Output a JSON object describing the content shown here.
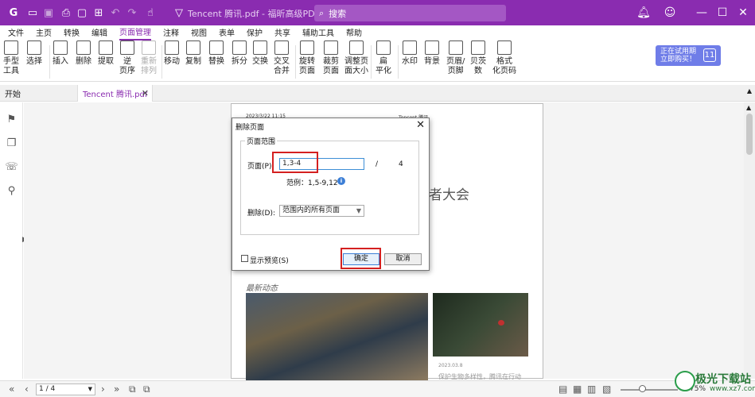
{
  "app": {
    "title": "Tencent 腾讯.pdf - 福昕高级PDF编辑器",
    "search_placeholder": "搜索",
    "accent": "#8a2cb0"
  },
  "menu": {
    "items": [
      "文件",
      "主页",
      "转换",
      "编辑",
      "页面管理",
      "注释",
      "视图",
      "表单",
      "保护",
      "共享",
      "辅助工具",
      "帮助"
    ],
    "active": "页面管理"
  },
  "ribbon": {
    "buttons": [
      {
        "label": "手型\n工具",
        "icon": "hand-icon"
      },
      {
        "label": "选择",
        "icon": "select-cursor-icon"
      },
      {
        "label": "插入",
        "icon": "insert-page-icon"
      },
      {
        "label": "删除",
        "icon": "delete-page-icon"
      },
      {
        "label": "提取",
        "icon": "extract-page-icon"
      },
      {
        "label": "逆\n页序",
        "icon": "reverse-order-icon"
      },
      {
        "label": "重新\n排列",
        "icon": "rearrange-icon"
      },
      {
        "label": "移动",
        "icon": "move-page-icon"
      },
      {
        "label": "复制",
        "icon": "copy-page-icon"
      },
      {
        "label": "替换",
        "icon": "replace-page-icon"
      },
      {
        "label": "拆分",
        "icon": "split-icon"
      },
      {
        "label": "交换",
        "icon": "swap-icon"
      },
      {
        "label": "交叉\n合并",
        "icon": "cross-merge-icon"
      },
      {
        "label": "旋转\n页面",
        "icon": "rotate-page-icon"
      },
      {
        "label": "裁剪\n页面",
        "icon": "crop-page-icon"
      },
      {
        "label": "调整页\n面大小",
        "icon": "resize-page-icon"
      },
      {
        "label": "扁\n平化",
        "icon": "flatten-icon"
      },
      {
        "label": "水印",
        "icon": "watermark-icon"
      },
      {
        "label": "背景",
        "icon": "background-icon"
      },
      {
        "label": "页眉/\n页脚",
        "icon": "header-footer-icon"
      },
      {
        "label": "贝茨\n数",
        "icon": "bates-number-icon"
      },
      {
        "label": "格式\n化页码",
        "icon": "format-page-number-icon"
      }
    ],
    "promo_line1": "正在试用期",
    "promo_line2": "立即购买！",
    "promo_badge": "11"
  },
  "tabs": [
    {
      "label": "开始"
    },
    {
      "label": "Tencent 腾讯.pdf"
    }
  ],
  "document": {
    "header_left": "2023/3/22 11:15",
    "header_right": "Tencent 腾讯",
    "title_fragment": "者大会",
    "section": "最新动态",
    "caption_date": "2023.03.8",
    "caption_text": "保护生物多样性，腾讯在行动"
  },
  "dialog": {
    "title": "删除页面",
    "group_label": "页面范围",
    "page_label": "页面(P):",
    "page_value": "1,3-4",
    "total_sep": "/",
    "total_pages": "4",
    "example": "范例：1,5-9,12",
    "delete_label": "删除(D):",
    "delete_option": "范围内的所有页面",
    "preview_label": "显示预览(S)",
    "ok_label": "确定",
    "cancel_label": "取消"
  },
  "status": {
    "page_indicator": "1 / 4",
    "zoom": "75%"
  },
  "watermark": {
    "brand": "极光下载站",
    "url": "www.xz7.com"
  }
}
